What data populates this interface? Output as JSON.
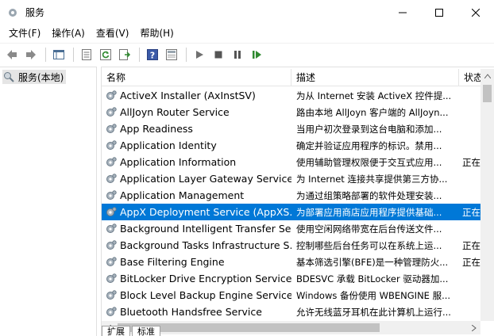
{
  "window": {
    "title": "服务"
  },
  "menu": [
    "文件(F)",
    "操作(A)",
    "查看(V)",
    "帮助(H)"
  ],
  "tree": {
    "label": "服务(本地)"
  },
  "columns": {
    "name": "名称",
    "desc": "描述",
    "status": "状态"
  },
  "services": [
    {
      "name": "ActiveX Installer (AxInstSV)",
      "desc": "为从 Internet 安装 ActiveX 控件提...",
      "status": ""
    },
    {
      "name": "AllJoyn Router Service",
      "desc": "路由本地 AllJoyn 客户端的 AllJoyn...",
      "status": ""
    },
    {
      "name": "App Readiness",
      "desc": "当用户初次登录到这台电脑和添加...",
      "status": ""
    },
    {
      "name": "Application Identity",
      "desc": "确定并验证应用程序的标识。禁用...",
      "status": ""
    },
    {
      "name": "Application Information",
      "desc": "使用辅助管理权限便于交互式应用...",
      "status": "正在"
    },
    {
      "name": "Application Layer Gateway Service",
      "desc": "为 Internet 连接共享提供第三方协...",
      "status": ""
    },
    {
      "name": "Application Management",
      "desc": "为通过组策略部署的软件处理安装...",
      "status": ""
    },
    {
      "name": "AppX Deployment Service (AppXS...",
      "desc": "为部署应用商店应用程序提供基础...",
      "status": "正在"
    },
    {
      "name": "Background Intelligent Transfer Se...",
      "desc": "使用空闲网络带宽在后台传送文件...",
      "status": ""
    },
    {
      "name": "Background Tasks Infrastructure S...",
      "desc": "控制哪些后台任务可以在系统上运...",
      "status": "正在"
    },
    {
      "name": "Base Filtering Engine",
      "desc": "基本筛选引擎(BFE)是一种管理防火...",
      "status": "正在"
    },
    {
      "name": "BitLocker Drive Encryption Service",
      "desc": "BDESVC 承载 BitLocker 驱动器加...",
      "status": ""
    },
    {
      "name": "Block Level Backup Engine Service",
      "desc": "Windows 备份使用 WBENGINE 服...",
      "status": ""
    },
    {
      "name": "Bluetooth Handsfree Service",
      "desc": "允许无线蓝牙耳机在此计算机上运行...",
      "status": ""
    }
  ],
  "selected_index": 7,
  "bottom_tabs": [
    "扩展",
    "标准"
  ],
  "colors": {
    "selection": "#0078d7",
    "accent": "#2f8a2f"
  }
}
